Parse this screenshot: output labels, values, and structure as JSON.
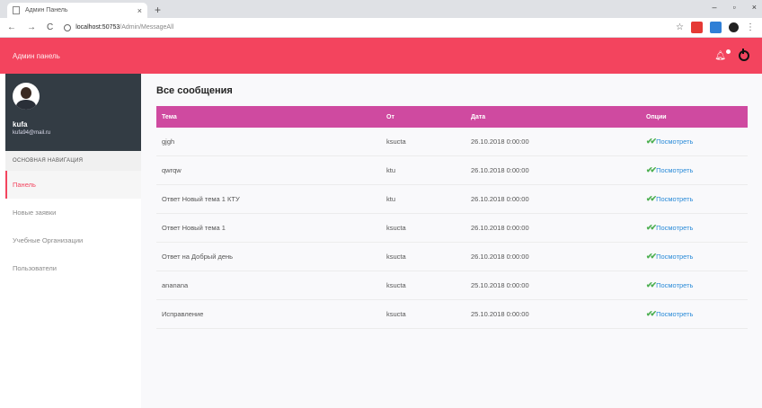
{
  "browser": {
    "tab_title": "Админ Панель",
    "tab_close": "×",
    "new_tab": "+",
    "url_host": "localhost:50753",
    "url_path": "/Admin/MessageAll",
    "win_min": "–",
    "win_max": "▫",
    "win_close": "×"
  },
  "header": {
    "brand": "Админ панель"
  },
  "sidebar": {
    "username": "kufa",
    "email": "kufa94@mail.ru",
    "section_title": "ОСНОВНАЯ НАВИГАЦИЯ",
    "items": [
      {
        "label": "Панель"
      },
      {
        "label": "Новые заявки"
      },
      {
        "label": "Учебные Организации"
      },
      {
        "label": "Пользователи"
      }
    ]
  },
  "main": {
    "title": "Все сообщения",
    "columns": [
      "Тема",
      "От",
      "Дата",
      "Опции"
    ],
    "rows": [
      {
        "topic": "gjgh",
        "from": "ksucta",
        "date": "26.10.2018 0:00:00",
        "action": "Посмотреть"
      },
      {
        "topic": "qwrqw",
        "from": "ktu",
        "date": "26.10.2018 0:00:00",
        "action": "Посмотреть"
      },
      {
        "topic": "Ответ Новый тема 1 КТУ",
        "from": "ktu",
        "date": "26.10.2018 0:00:00",
        "action": "Посмотреть"
      },
      {
        "topic": "Ответ Новый тема 1",
        "from": "ksucta",
        "date": "26.10.2018 0:00:00",
        "action": "Посмотреть"
      },
      {
        "topic": "Ответ на Добрый день",
        "from": "ksucta",
        "date": "26.10.2018 0:00:00",
        "action": "Посмотреть"
      },
      {
        "topic": "ananana",
        "from": "ksucta",
        "date": "25.10.2018 0:00:00",
        "action": "Посмотреть"
      },
      {
        "topic": "Исправление",
        "from": "ksucta",
        "date": "25.10.2018 0:00:00",
        "action": "Посмотреть"
      }
    ]
  },
  "colors": {
    "header_bg": "#f3445e",
    "table_header_bg": "#cf4aa0",
    "link": "#2a8bd8",
    "check": "#4caf50",
    "sidebar_profile_bg": "#333c44"
  }
}
